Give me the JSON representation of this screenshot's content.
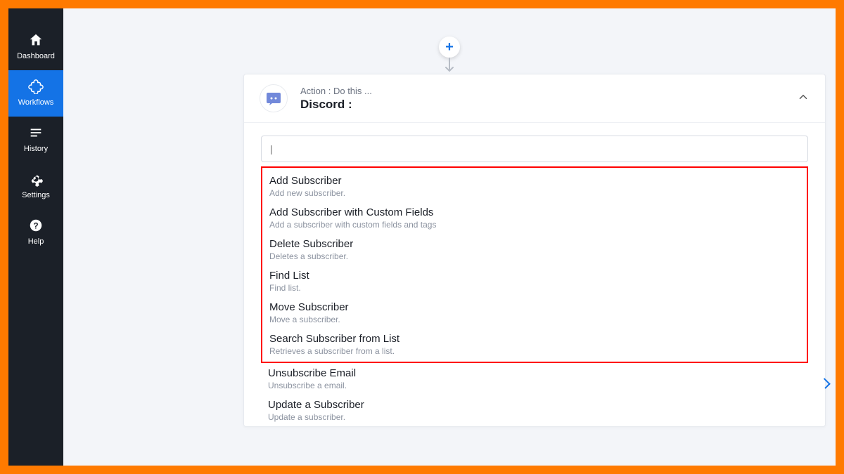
{
  "sidebar": {
    "items": [
      {
        "label": "Dashboard"
      },
      {
        "label": "Workflows"
      },
      {
        "label": "History"
      },
      {
        "label": "Settings"
      },
      {
        "label": "Help"
      }
    ]
  },
  "card": {
    "subtitle": "Action : Do this ...",
    "title": "Discord :",
    "search_placeholder": "|"
  },
  "highlighted_options": [
    {
      "title": "Add Subscriber",
      "desc": "Add new subscriber."
    },
    {
      "title": "Add Subscriber with Custom Fields",
      "desc": "Add a subscriber with custom fields and tags"
    },
    {
      "title": "Delete Subscriber",
      "desc": "Deletes a subscriber."
    },
    {
      "title": "Find List",
      "desc": "Find list."
    },
    {
      "title": "Move Subscriber",
      "desc": "Move a subscriber."
    },
    {
      "title": "Search Subscriber from List",
      "desc": "Retrieves a subscriber from a list."
    }
  ],
  "plain_options": [
    {
      "title": "Unsubscribe Email",
      "desc": "Unsubscribe a email."
    },
    {
      "title": "Update a Subscriber",
      "desc": "Update a subscriber."
    }
  ]
}
